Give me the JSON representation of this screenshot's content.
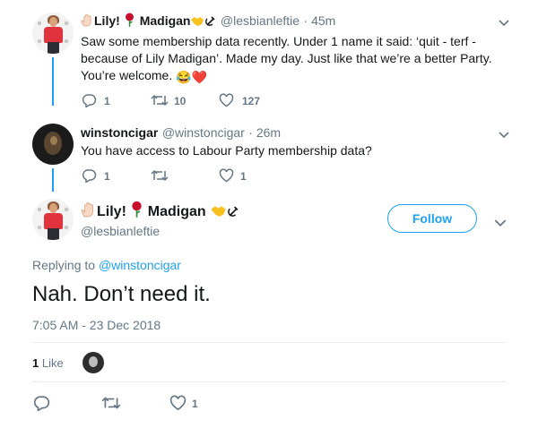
{
  "tweets": [
    {
      "name_text1": "Lily!",
      "name_text2": "Madigan",
      "handle": "@lesbianleftie",
      "time": "· 45m",
      "text": "Saw some membership data recently. Under 1 name it said: ‘quit - terf - because of Lily Madigan’. Made my day. Just like that we’re a better Party. You’re welcome.",
      "emojis": "😂❤️",
      "reply_count": "1",
      "retweet_count": "10",
      "like_count": "127"
    },
    {
      "name": "winstoncigar",
      "handle": "@winstoncigar",
      "time": "· 26m",
      "text": "You have access to Labour Party membership data?",
      "reply_count": "1",
      "retweet_count": "",
      "like_count": "1"
    }
  ],
  "main_tweet": {
    "name_text1": "Lily!",
    "name_text2": "Madigan",
    "handle": "@lesbianleftie",
    "follow_label": "Follow",
    "replying_prefix": "Replying to",
    "replying_to": "@winstoncigar",
    "text": "Nah. Don’t need it.",
    "timestamp": "7:05 AM - 23 Dec 2018",
    "likes_number": "1",
    "likes_label": "Like",
    "like_count": "1"
  },
  "colors": {
    "accent": "#1da1f2",
    "text": "#14171a",
    "muted": "#657786",
    "divider": "#e6ecf0"
  },
  "icons": [
    "reply-icon",
    "retweet-icon",
    "heart-icon",
    "chevron-down-icon",
    "raised-hand-emoji",
    "rose-emoji",
    "handshake-emoji",
    "hammer-sickle-emoji"
  ]
}
